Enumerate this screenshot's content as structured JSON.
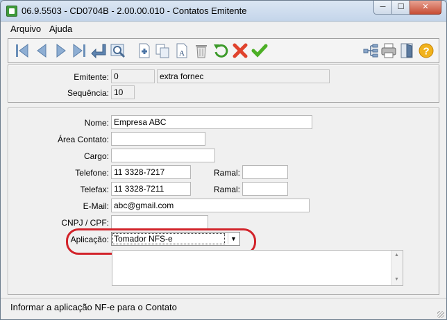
{
  "window": {
    "title": "06.9.5503 - CD0704B - 2.00.00.010 - Contatos Emitente",
    "min_glyph": "─",
    "max_glyph": "☐",
    "close_glyph": "✕"
  },
  "menu": {
    "items": [
      "Arquivo",
      "Ajuda"
    ]
  },
  "toolbar": {
    "icons": [
      "first-icon",
      "previous-icon",
      "next-icon",
      "last-icon",
      "goto-icon",
      "search-zoom-icon",
      "add-icon",
      "copy-icon",
      "edit-icon",
      "delete-icon",
      "undo-icon",
      "cancel-icon",
      "confirm-icon",
      "tree-icon",
      "print-icon",
      "exit-icon",
      "help-icon"
    ]
  },
  "header": {
    "emitente_label": "Emitente:",
    "emitente_code": "0",
    "emitente_name": "extra fornec",
    "sequencia_label": "Sequência:",
    "sequencia_value": "10"
  },
  "form": {
    "nome_label": "Nome:",
    "nome_value": "Empresa ABC",
    "area_label": "Área Contato:",
    "area_value": "",
    "cargo_label": "Cargo:",
    "cargo_value": "",
    "telefone_label": "Telefone:",
    "telefone_value": "11 3328-7217",
    "ramal_label": "Ramal:",
    "ramal_value": "",
    "telefax_label": "Telefax:",
    "telefax_value": "11 3328-7211",
    "ramal2_label": "Ramal:",
    "ramal2_value": "",
    "email_label": "E-Mail:",
    "email_value": "abc@gmail.com",
    "cnpj_label": "CNPJ / CPF:",
    "cnpj_value": "",
    "aplicacao_label": "Aplicação:",
    "aplicacao_value": "Tomador NFS-e"
  },
  "status": {
    "text": "Informar a aplicação NF-e para o Contato"
  },
  "colors": {
    "highlight": "#d2232a",
    "accent": "#3e9a3a"
  }
}
